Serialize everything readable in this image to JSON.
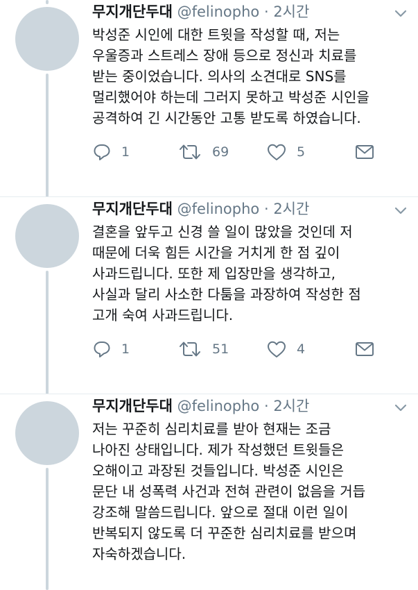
{
  "tweets": [
    {
      "name": "무지개단두대",
      "handle": "@felinopho",
      "separator": "·",
      "time": "2시간",
      "lines": [
        "박성준 시인에 대한 트윗을 작성할 때, 저는",
        "우울증과 스트레스 장애 등으로 정신과 치료를",
        "받는 중이었습니다. 의사의 소견대로 SNS를",
        "멀리했어야 하는데 그러지 못하고 박성준 시인을",
        "공격하여 긴 시간동안 고통 받도록 하였습니다."
      ],
      "replies": "1",
      "retweets": "69",
      "likes": "5"
    },
    {
      "name": "무지개단두대",
      "handle": "@felinopho",
      "separator": "·",
      "time": "2시간",
      "lines": [
        "결혼을 앞두고 신경 쓸 일이 많았을 것인데 저",
        "때문에 더욱 힘든 시간을 거치게 한 점 깊이",
        "사과드립니다. 또한 제 입장만을 생각하고,",
        "사실과 달리 사소한 다툼을 과장하여 작성한 점",
        "고개 숙여 사과드립니다."
      ],
      "replies": "1",
      "retweets": "51",
      "likes": "4"
    },
    {
      "name": "무지개단두대",
      "handle": "@felinopho",
      "separator": "·",
      "time": "2시간",
      "lines": [
        "저는 꾸준히 심리치료를 받아 현재는 조금",
        "나아진 상태입니다. 제가 작성했던 트윗들은",
        "오해이고 과장된 것들입니다. 박성준 시인은",
        "문단 내 성폭력 사건과 전혀 관련이 없음을 거듭",
        "강조해 말씀드립니다. 앞으로 절대 이런 일이",
        "반복되지 않도록 더 꾸준한 심리치료를 받으며",
        "자숙하겠습니다."
      ]
    }
  ]
}
